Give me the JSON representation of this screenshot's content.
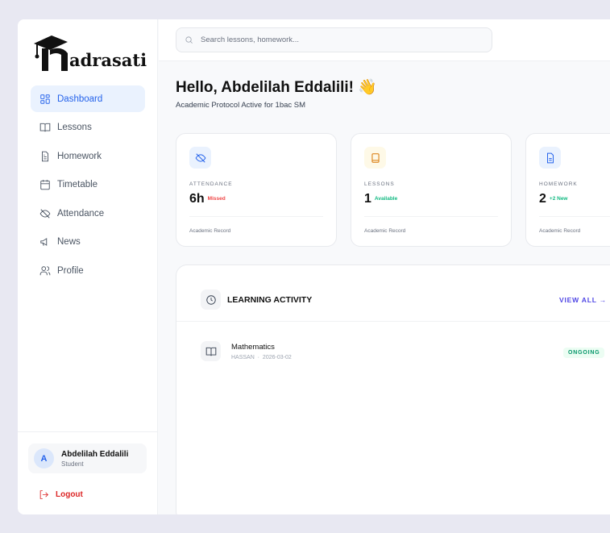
{
  "brand": {
    "name": "madrasati"
  },
  "sidebar": {
    "items": [
      {
        "label": "Dashboard",
        "icon": "dashboard-icon",
        "active": true
      },
      {
        "label": "Lessons",
        "icon": "book-open-icon"
      },
      {
        "label": "Homework",
        "icon": "file-text-icon"
      },
      {
        "label": "Timetable",
        "icon": "calendar-icon"
      },
      {
        "label": "Attendance",
        "icon": "eye-off-icon"
      },
      {
        "label": "News",
        "icon": "megaphone-icon"
      },
      {
        "label": "Profile",
        "icon": "users-icon"
      }
    ],
    "user": {
      "initial": "A",
      "name": "Abdelilah Eddalili",
      "role": "Student"
    },
    "logout": "Logout"
  },
  "header": {
    "search_placeholder": "Search lessons, homework..."
  },
  "greeting": {
    "title": "Hello, Abdelilah Eddalili! 👋",
    "subtitle": "Academic Protocol Active for 1bac SM"
  },
  "cards": [
    {
      "label": "ATTENDANCE",
      "value": "6h",
      "note": "Missed",
      "note_color": "#ef4444",
      "footer": "Academic Record",
      "icon": "eye-off-icon"
    },
    {
      "label": "LESSONS",
      "value": "1",
      "note": "Available",
      "note_color": "#10b981",
      "footer": "Academic Record",
      "icon": "book-icon"
    },
    {
      "label": "HOMEWORK",
      "value": "2",
      "note": "+2 New",
      "note_color": "#10b981",
      "footer": "Academic Record",
      "icon": "file-text-icon"
    }
  ],
  "activity": {
    "title": "LEARNING ACTIVITY",
    "view_all": "VIEW ALL →",
    "items": [
      {
        "subject": "Mathematics",
        "teacher": "HASSAN",
        "date": "2026-03-02",
        "status": "ONGOING"
      }
    ]
  }
}
